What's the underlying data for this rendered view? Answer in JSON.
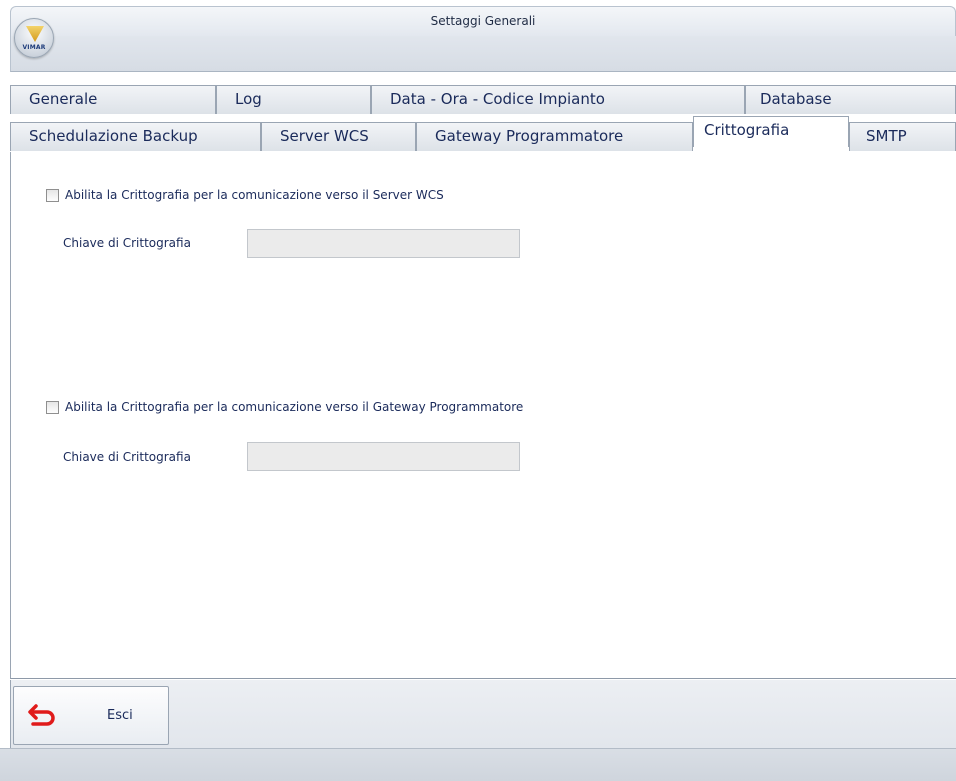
{
  "window": {
    "title": "Settaggi Generali"
  },
  "logo": {
    "text": "VIMAR"
  },
  "tabs": {
    "row1": [
      {
        "label": "Generale"
      },
      {
        "label": "Log"
      },
      {
        "label": "Data - Ora - Codice Impianto"
      },
      {
        "label": "Database"
      }
    ],
    "row2": [
      {
        "label": "Schedulazione Backup"
      },
      {
        "label": "Server WCS"
      },
      {
        "label": "Gateway Programmatore"
      },
      {
        "label": "Crittografia",
        "active": true
      },
      {
        "label": "SMTP"
      }
    ]
  },
  "crypto": {
    "server": {
      "checkbox_label": "Abilita la Crittografia per la comunicazione verso il Server WCS",
      "checked": false,
      "key_label": "Chiave di Crittografia",
      "key_value": ""
    },
    "gateway": {
      "checkbox_label": "Abilita la Crittografia per la comunicazione verso il Gateway Programmatore",
      "checked": false,
      "key_label": "Chiave di Crittografia",
      "key_value": ""
    }
  },
  "footer": {
    "exit_label": "Esci",
    "exit_icon": "return-arrow-icon",
    "exit_icon_color": "#e01b1b"
  }
}
